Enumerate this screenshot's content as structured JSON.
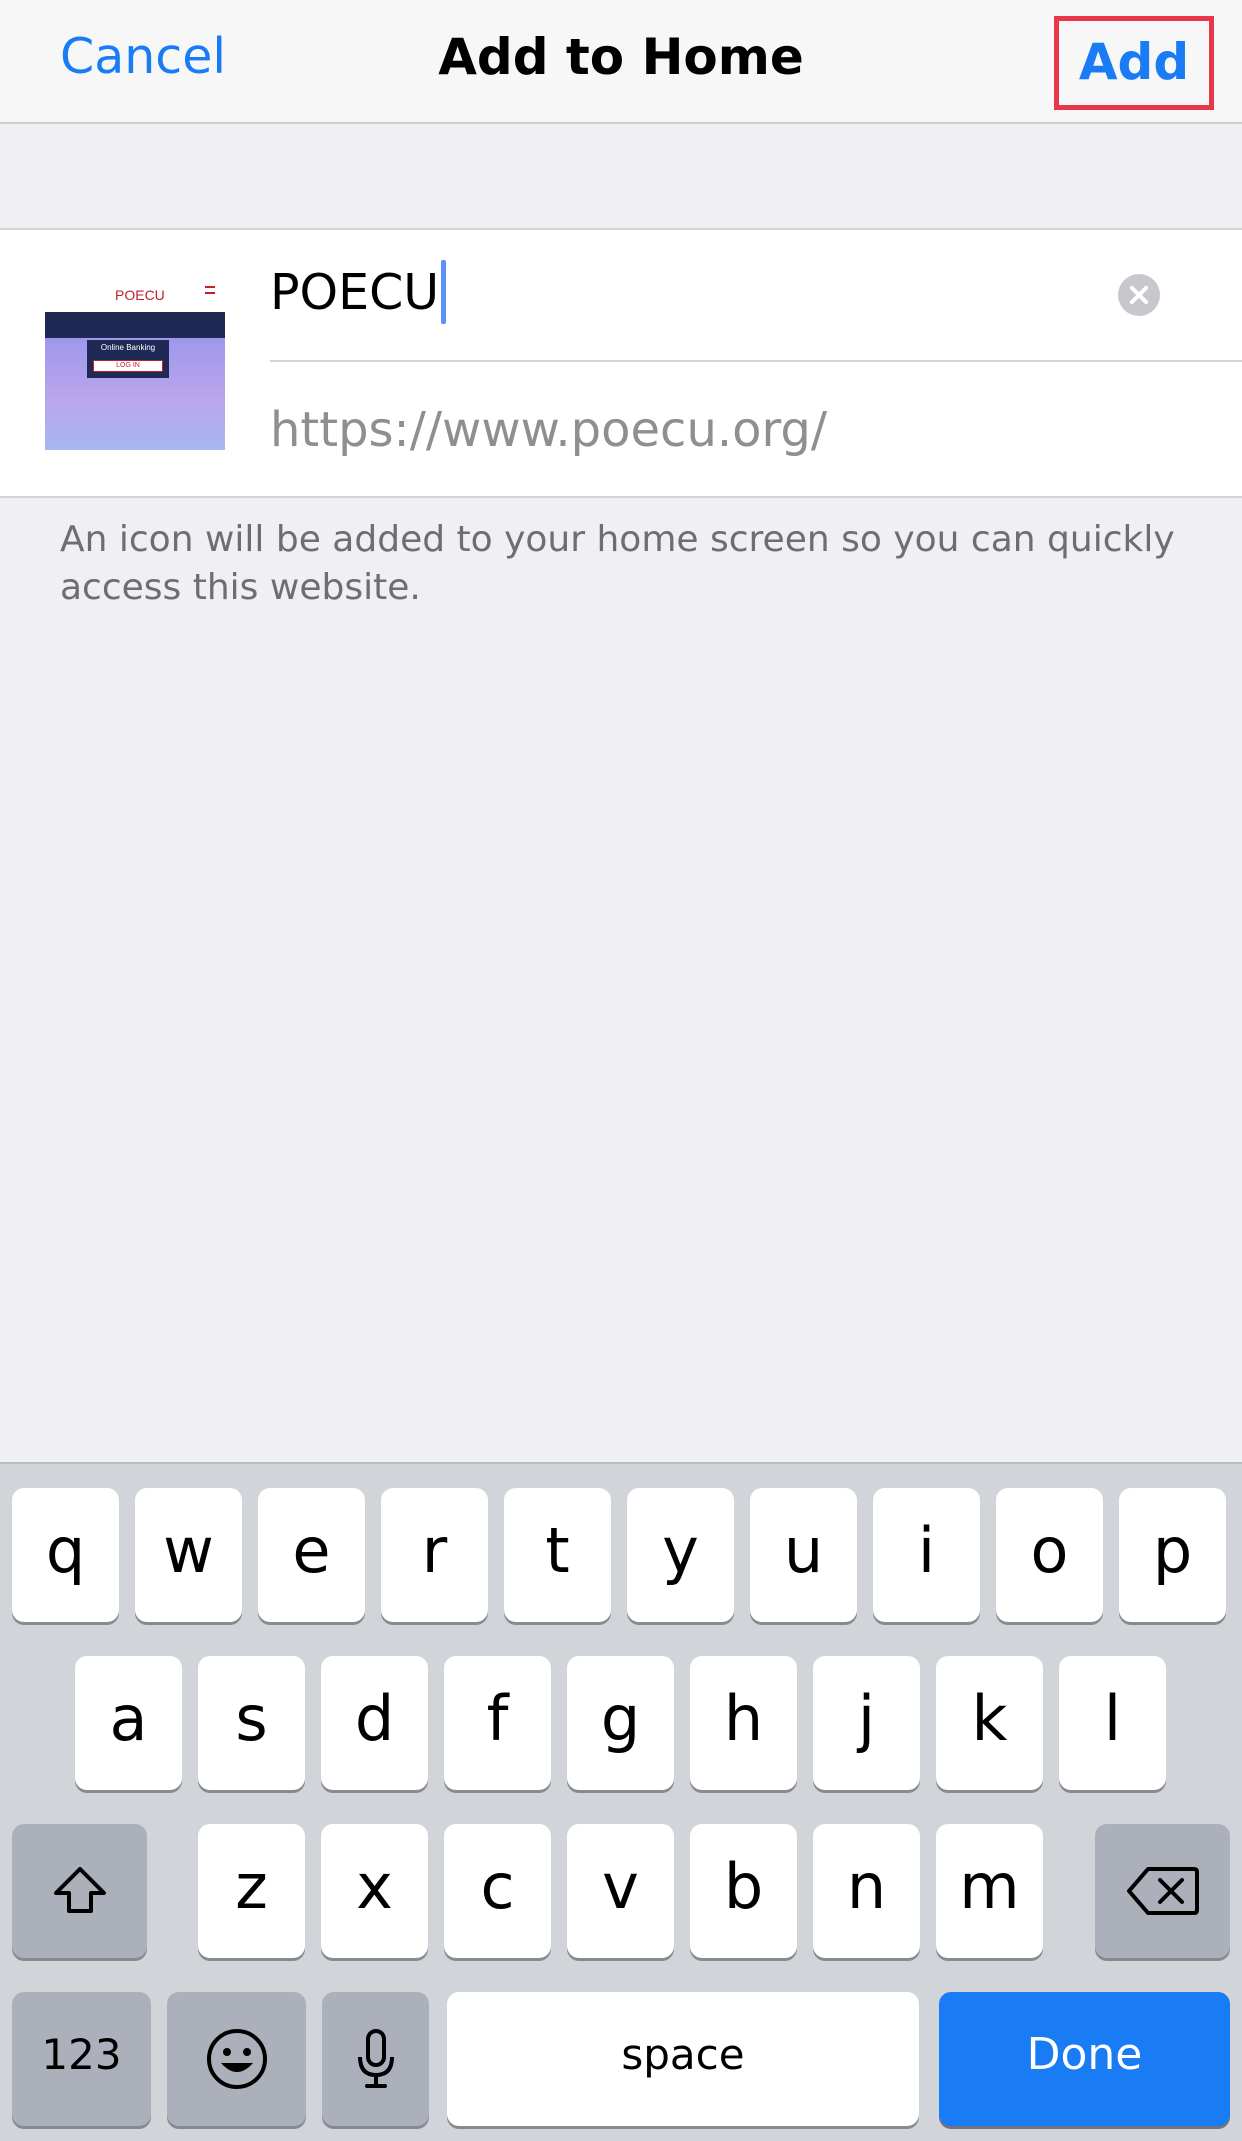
{
  "navbar": {
    "cancel_label": "Cancel",
    "title": "Add to Home",
    "add_label": "Add",
    "accent_color": "#1a7cf5",
    "highlight_color": "#e8374a"
  },
  "form": {
    "thumbnail_logo": "POECU",
    "thumbnail_button": "LOG IN",
    "thumbnail_caption": "Online Banking",
    "name_value": "POECU",
    "url_value": "https://www.poecu.org/"
  },
  "helper_text": "An icon will be added to your home screen so you can quickly access this website.",
  "keyboard": {
    "row1": [
      "q",
      "w",
      "e",
      "r",
      "t",
      "y",
      "u",
      "i",
      "o",
      "p"
    ],
    "row2": [
      "a",
      "s",
      "d",
      "f",
      "g",
      "h",
      "j",
      "k",
      "l"
    ],
    "row3": [
      "z",
      "x",
      "c",
      "v",
      "b",
      "n",
      "m"
    ],
    "numbers_label": "123",
    "space_label": "space",
    "done_label": "Done",
    "icons": {
      "shift": "shift-icon",
      "delete": "delete-icon",
      "emoji": "emoji-icon",
      "mic": "microphone-icon"
    }
  }
}
